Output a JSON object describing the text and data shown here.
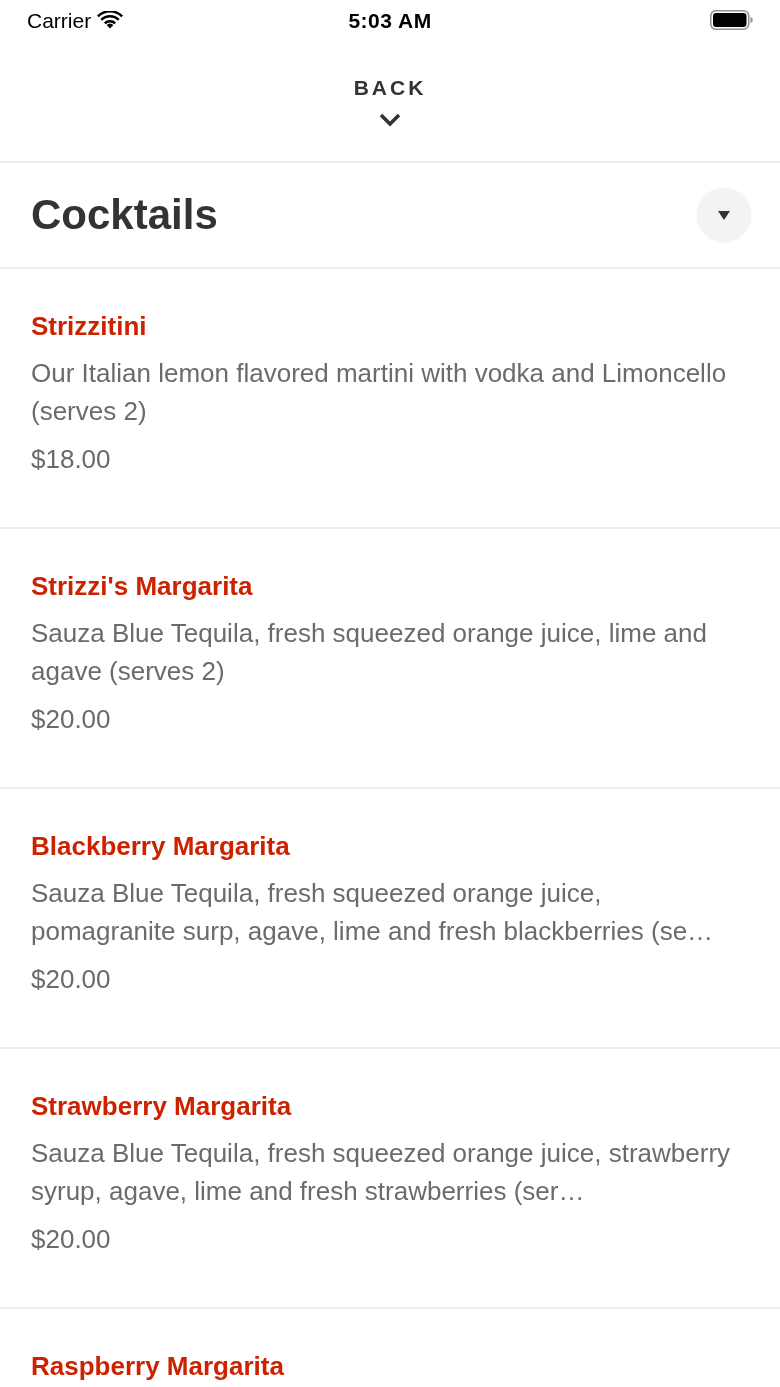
{
  "status_bar": {
    "carrier": "Carrier",
    "time": "5:03 AM"
  },
  "nav": {
    "back_label": "BACK"
  },
  "section": {
    "title": "Cocktails"
  },
  "items": [
    {
      "name": "Strizzitini",
      "description": "Our Italian lemon flavored martini with vodka and Limoncello (serves 2)",
      "price": "$18.00"
    },
    {
      "name": "Strizzi's Margarita",
      "description": "Sauza Blue Tequila, fresh squeezed orange juice, lime and agave (serves 2)",
      "price": "$20.00"
    },
    {
      "name": "Blackberry Margarita",
      "description": "Sauza Blue Tequila, fresh squeezed orange juice, pomagranite surp, agave, lime and fresh blackberries (se…",
      "price": "$20.00"
    },
    {
      "name": "Strawberry Margarita",
      "description": "Sauza Blue Tequila, fresh squeezed orange juice, strawberry syrup, agave, lime and fresh strawberries (ser…",
      "price": "$20.00"
    },
    {
      "name": "Raspberry Margarita"
    }
  ]
}
